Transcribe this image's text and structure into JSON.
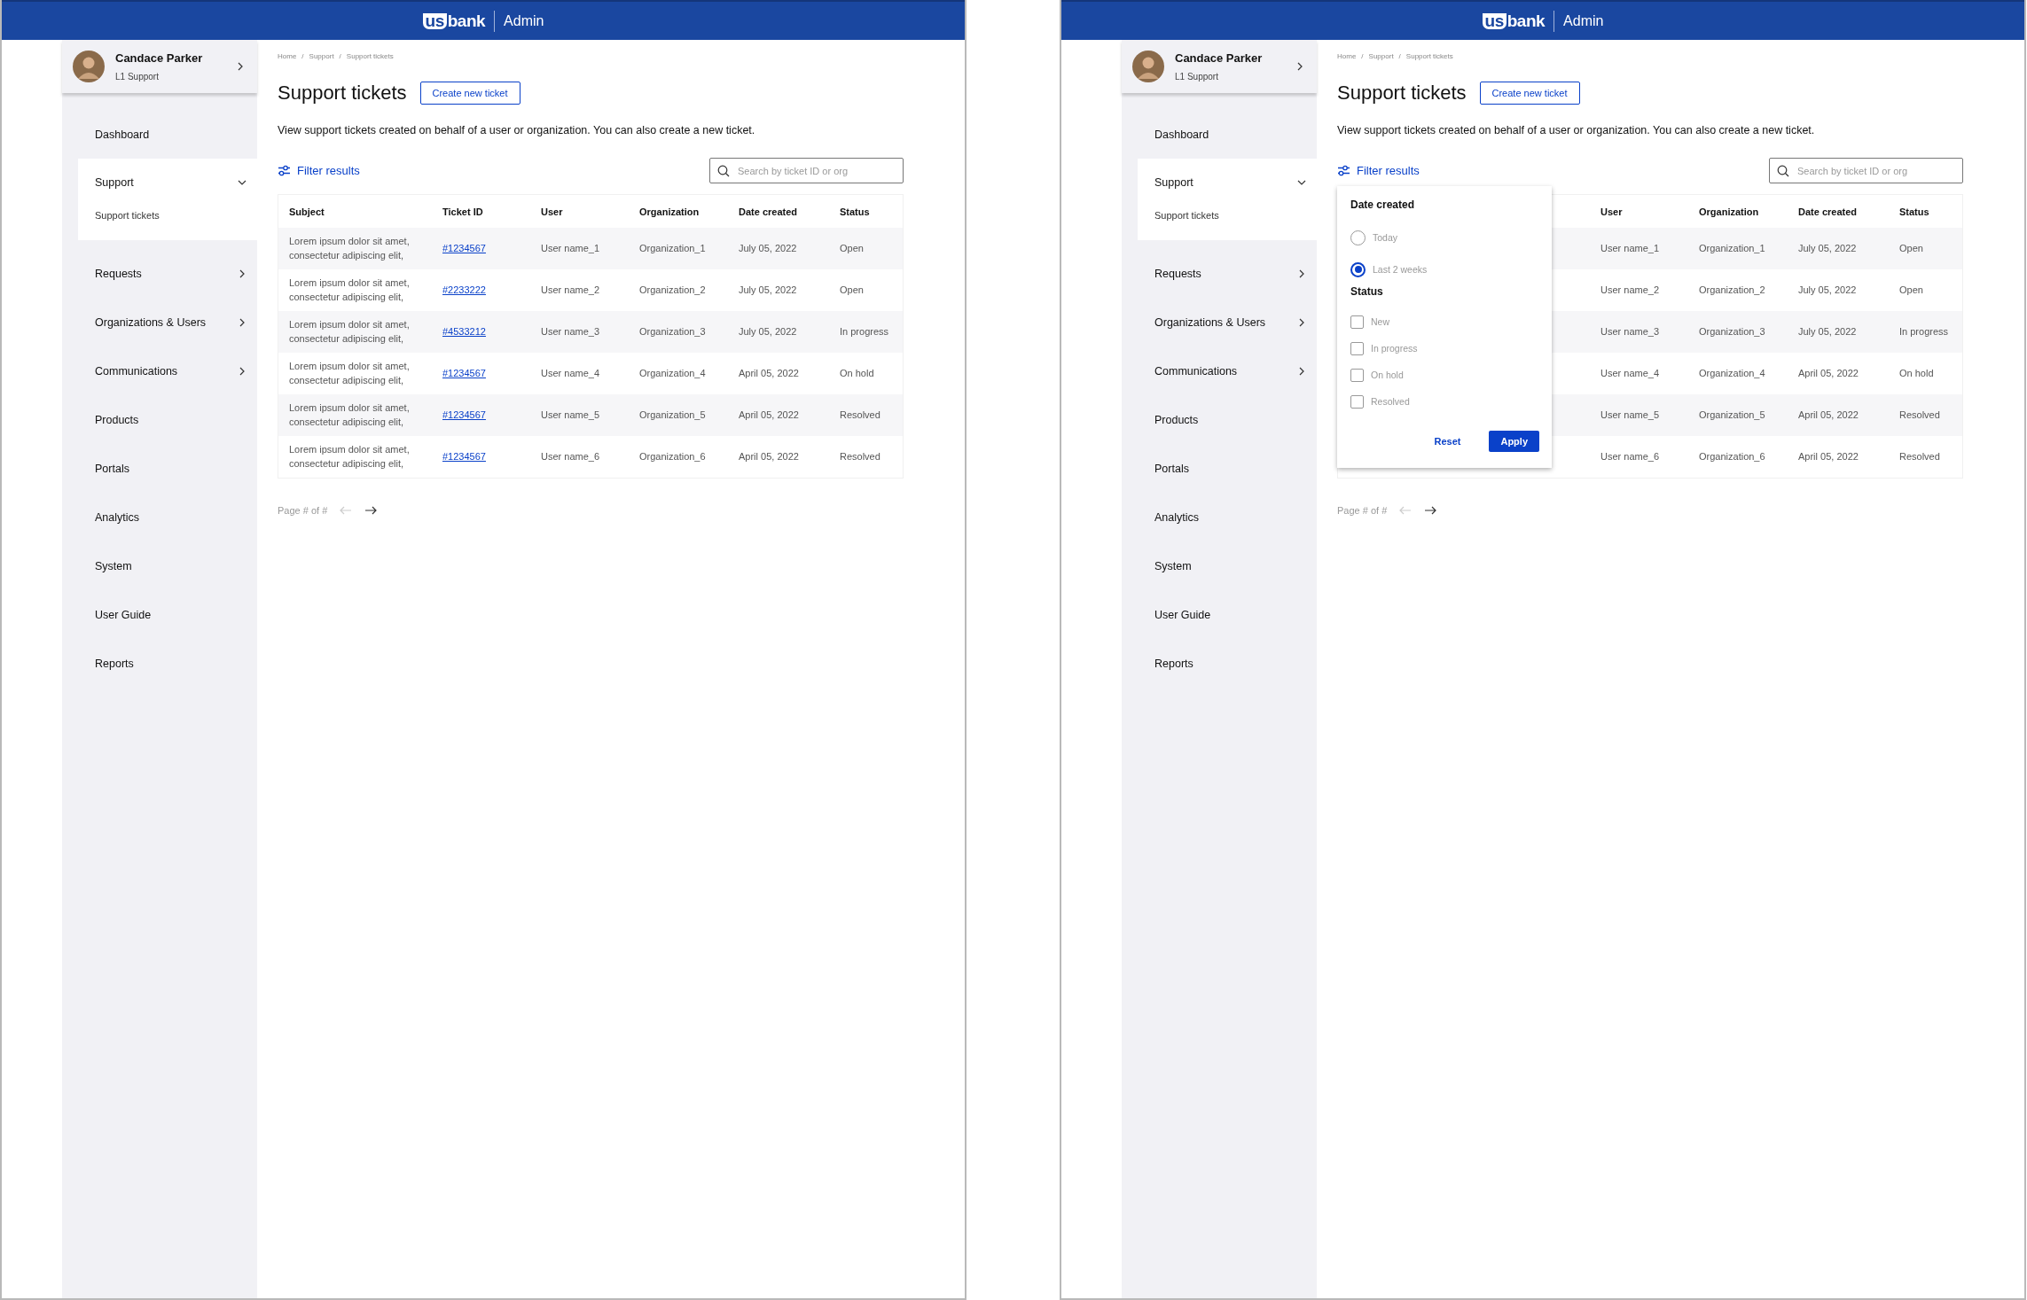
{
  "screens": [
    {
      "header": {
        "logo_mark": "us",
        "logo_word": "bank",
        "title": "Admin"
      },
      "profile": {
        "name": "Candace Parker",
        "role": "L1 Support"
      },
      "nav": [
        {
          "label": "Dashboard",
          "kind": "link"
        },
        {
          "label": "Support",
          "kind": "group",
          "expanded": true,
          "children": [
            {
              "label": "Support tickets"
            }
          ]
        },
        {
          "label": "Requests",
          "kind": "group",
          "expanded": false
        },
        {
          "label": "Organizations & Users",
          "kind": "group",
          "expanded": false
        },
        {
          "label": "Communications",
          "kind": "group",
          "expanded": false
        },
        {
          "label": "Products",
          "kind": "link"
        },
        {
          "label": "Portals",
          "kind": "link"
        },
        {
          "label": "Analytics",
          "kind": "link"
        },
        {
          "label": "System",
          "kind": "link"
        },
        {
          "label": "User Guide",
          "kind": "link"
        },
        {
          "label": "Reports",
          "kind": "link"
        }
      ],
      "breadcrumb": [
        {
          "label": "Home"
        },
        {
          "separator": "/"
        },
        {
          "label": "Support"
        },
        {
          "separator": "/"
        },
        {
          "label": "Support tickets"
        }
      ],
      "title": "Support tickets",
      "create_button": "Create new ticket",
      "description": "View support tickets created on behalf of a user or organization. You can also create a new ticket.",
      "filter_link": "Filter results",
      "search": {
        "placeholder": "Search by ticket ID or org"
      },
      "table": {
        "columns": [
          "Subject",
          "Ticket ID",
          "User",
          "Organization",
          "Date created",
          "Status"
        ],
        "rows": [
          {
            "cells": [
              "Lorem ipsum dolor sit amet, consectetur adipiscing elit,",
              "#1234567",
              "User name_1",
              "Organization_1",
              "July 05, 2022",
              "Open"
            ]
          },
          {
            "cells": [
              "Lorem ipsum dolor sit amet, consectetur adipiscing elit,",
              "#2233222",
              "User name_2",
              "Organization_2",
              "July 05, 2022",
              "Open"
            ]
          },
          {
            "cells": [
              "Lorem ipsum dolor sit amet, consectetur adipiscing elit,",
              "#4533212",
              "User name_3",
              "Organization_3",
              "July 05, 2022",
              "In progress"
            ]
          },
          {
            "cells": [
              "Lorem ipsum dolor sit amet, consectetur adipiscing elit,",
              "#1234567",
              "User name_4",
              "Organization_4",
              "April 05, 2022",
              "On hold"
            ]
          },
          {
            "cells": [
              "Lorem ipsum dolor sit amet, consectetur adipiscing elit,",
              "#1234567",
              "User name_5",
              "Organization_5",
              "April 05, 2022",
              "Resolved"
            ]
          },
          {
            "cells": [
              "Lorem ipsum dolor sit amet, consectetur adipiscing elit,",
              "#1234567",
              "User name_6",
              "Organization_6",
              "April 05, 2022",
              "Resolved"
            ]
          }
        ]
      },
      "pagination": {
        "label": "Page # of #",
        "previous_disabled": true,
        "next_disabled": false
      }
    },
    {
      "header": {
        "logo_mark": "us",
        "logo_word": "bank",
        "title": "Admin"
      },
      "profile": {
        "name": "Candace Parker",
        "role": "L1 Support"
      },
      "nav": [
        {
          "label": "Dashboard",
          "kind": "link"
        },
        {
          "label": "Support",
          "kind": "group",
          "expanded": true,
          "children": [
            {
              "label": "Support tickets"
            }
          ]
        },
        {
          "label": "Requests",
          "kind": "group",
          "expanded": false
        },
        {
          "label": "Organizations & Users",
          "kind": "group",
          "expanded": false
        },
        {
          "label": "Communications",
          "kind": "group",
          "expanded": false
        },
        {
          "label": "Products",
          "kind": "link"
        },
        {
          "label": "Portals",
          "kind": "link"
        },
        {
          "label": "Analytics",
          "kind": "link"
        },
        {
          "label": "System",
          "kind": "link"
        },
        {
          "label": "User Guide",
          "kind": "link"
        },
        {
          "label": "Reports",
          "kind": "link"
        }
      ],
      "breadcrumb": [
        {
          "label": "Home"
        },
        {
          "separator": "/"
        },
        {
          "label": "Support"
        },
        {
          "separator": "/"
        },
        {
          "label": "Support tickets"
        }
      ],
      "title": "Support tickets",
      "create_button": "Create new ticket",
      "description": "View support tickets created on behalf of a user or organization. You can also create a new ticket.",
      "filter_link": "Filter results",
      "search": {
        "placeholder": "Search by ticket ID or org"
      },
      "filter_popup": {
        "sections": [
          {
            "title": "Date created",
            "kind": "radio",
            "options": [
              {
                "label": "Today",
                "selected": false
              },
              {
                "label": "Last 2 weeks",
                "selected": true
              }
            ]
          },
          {
            "title": "Status",
            "kind": "checkbox",
            "options": [
              {
                "label": "New",
                "checked": false
              },
              {
                "label": "In progress",
                "checked": false
              },
              {
                "label": "On hold",
                "checked": false
              },
              {
                "label": "Resolved",
                "checked": false
              }
            ]
          }
        ],
        "reset": "Reset",
        "apply": "Apply"
      },
      "table": {
        "columns": [
          "User",
          "Organization",
          "Date created",
          "Status"
        ],
        "rows": [
          {
            "cells": [
              "User name_1",
              "Organization_1",
              "July 05, 2022",
              "Open"
            ]
          },
          {
            "cells": [
              "User name_2",
              "Organization_2",
              "July 05, 2022",
              "Open"
            ]
          },
          {
            "cells": [
              "User name_3",
              "Organization_3",
              "July 05, 2022",
              "In progress"
            ]
          },
          {
            "cells": [
              "User name_4",
              "Organization_4",
              "April 05, 2022",
              "On hold"
            ]
          },
          {
            "cells": [
              "User name_5",
              "Organization_5",
              "April 05, 2022",
              "Resolved"
            ]
          },
          {
            "cells": [
              "User name_6",
              "Organization_6",
              "April 05, 2022",
              "Resolved"
            ]
          }
        ]
      },
      "pagination": {
        "label": "Page # of #",
        "previous_disabled": true,
        "next_disabled": false
      }
    }
  ]
}
